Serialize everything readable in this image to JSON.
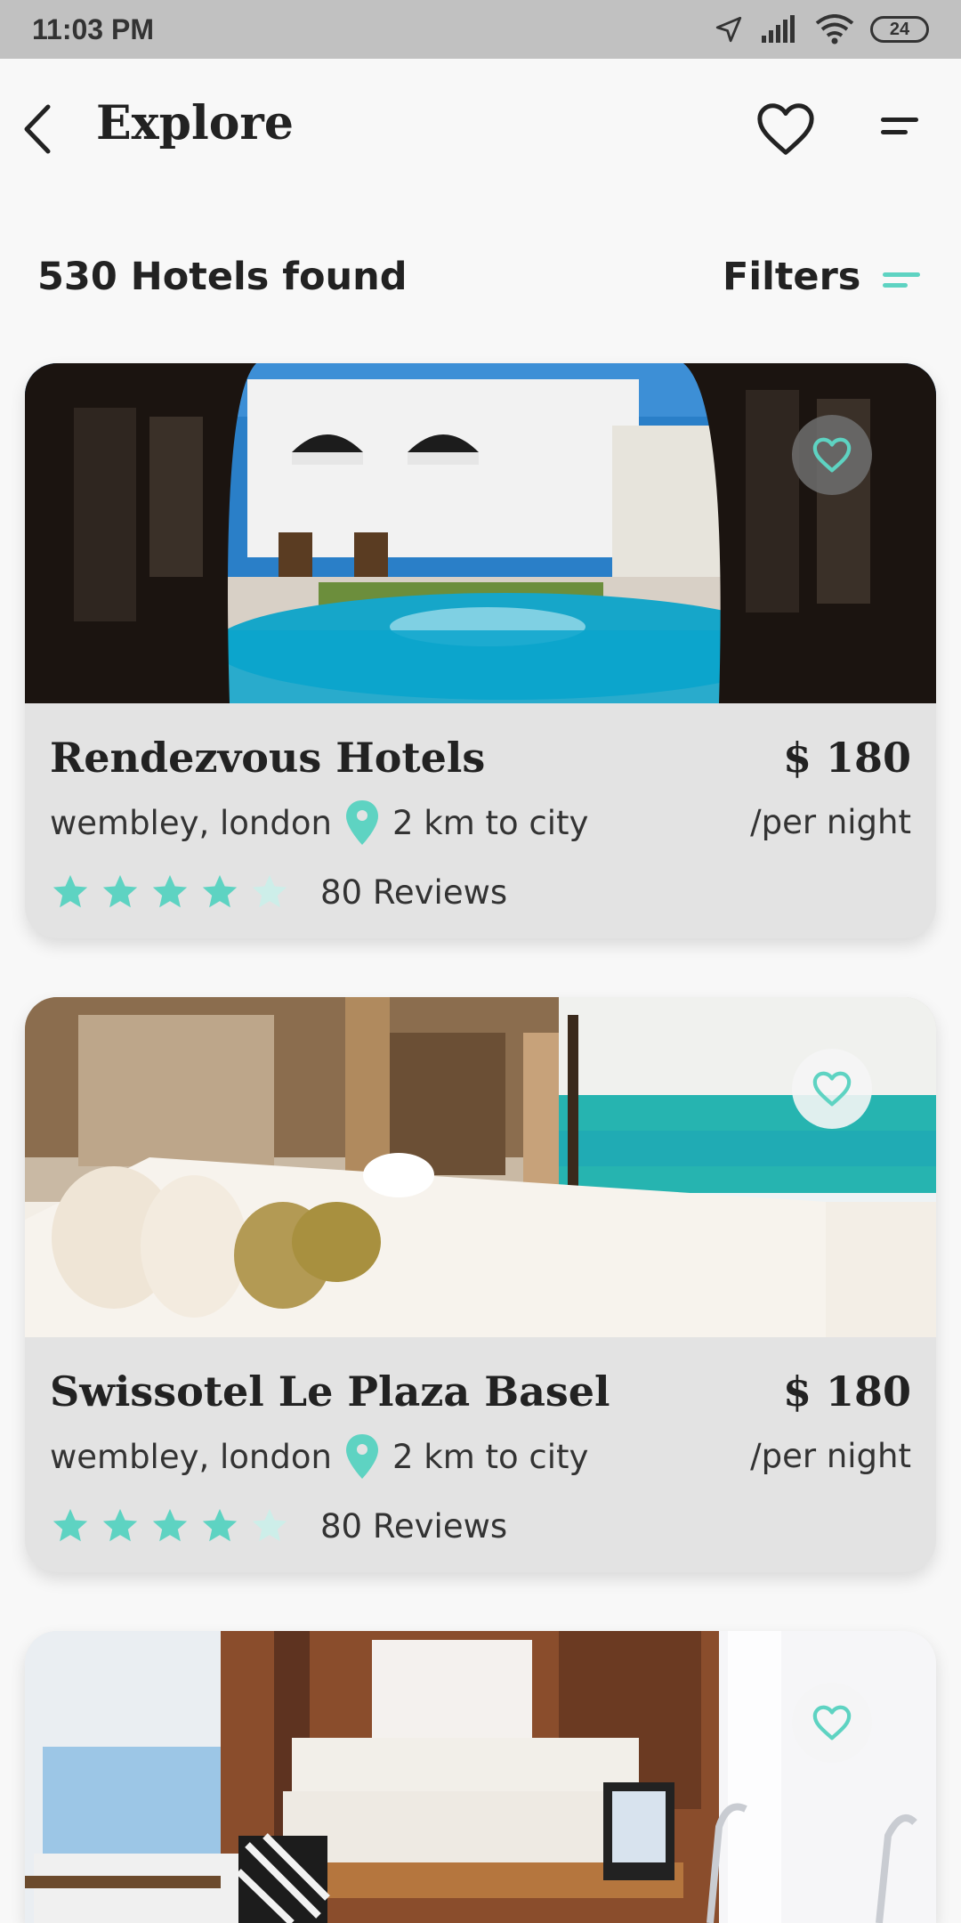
{
  "status_bar": {
    "time": "11:03 PM",
    "battery": "24"
  },
  "header": {
    "title": "Explore"
  },
  "results": {
    "count_label": "530 Hotels found",
    "filters_label": "Filters"
  },
  "colors": {
    "accent": "#5ed3c2",
    "card_bg": "#e3e3e3",
    "page_bg": "#f8f8f8",
    "status_bar": "#c1c1c1"
  },
  "hotels": [
    {
      "name": "Rendezvous Hotels",
      "price": "$ 180",
      "per_night": "/per night",
      "location": "wembley, london",
      "distance": "2 km to city",
      "rating": 4,
      "reviews": "80 Reviews",
      "favorite": false
    },
    {
      "name": "Swissotel Le Plaza Basel",
      "price": "$ 180",
      "per_night": "/per night",
      "location": "wembley, london",
      "distance": "2 km to city",
      "rating": 4,
      "reviews": "80 Reviews",
      "favorite": false
    },
    {
      "favorite": false
    }
  ]
}
